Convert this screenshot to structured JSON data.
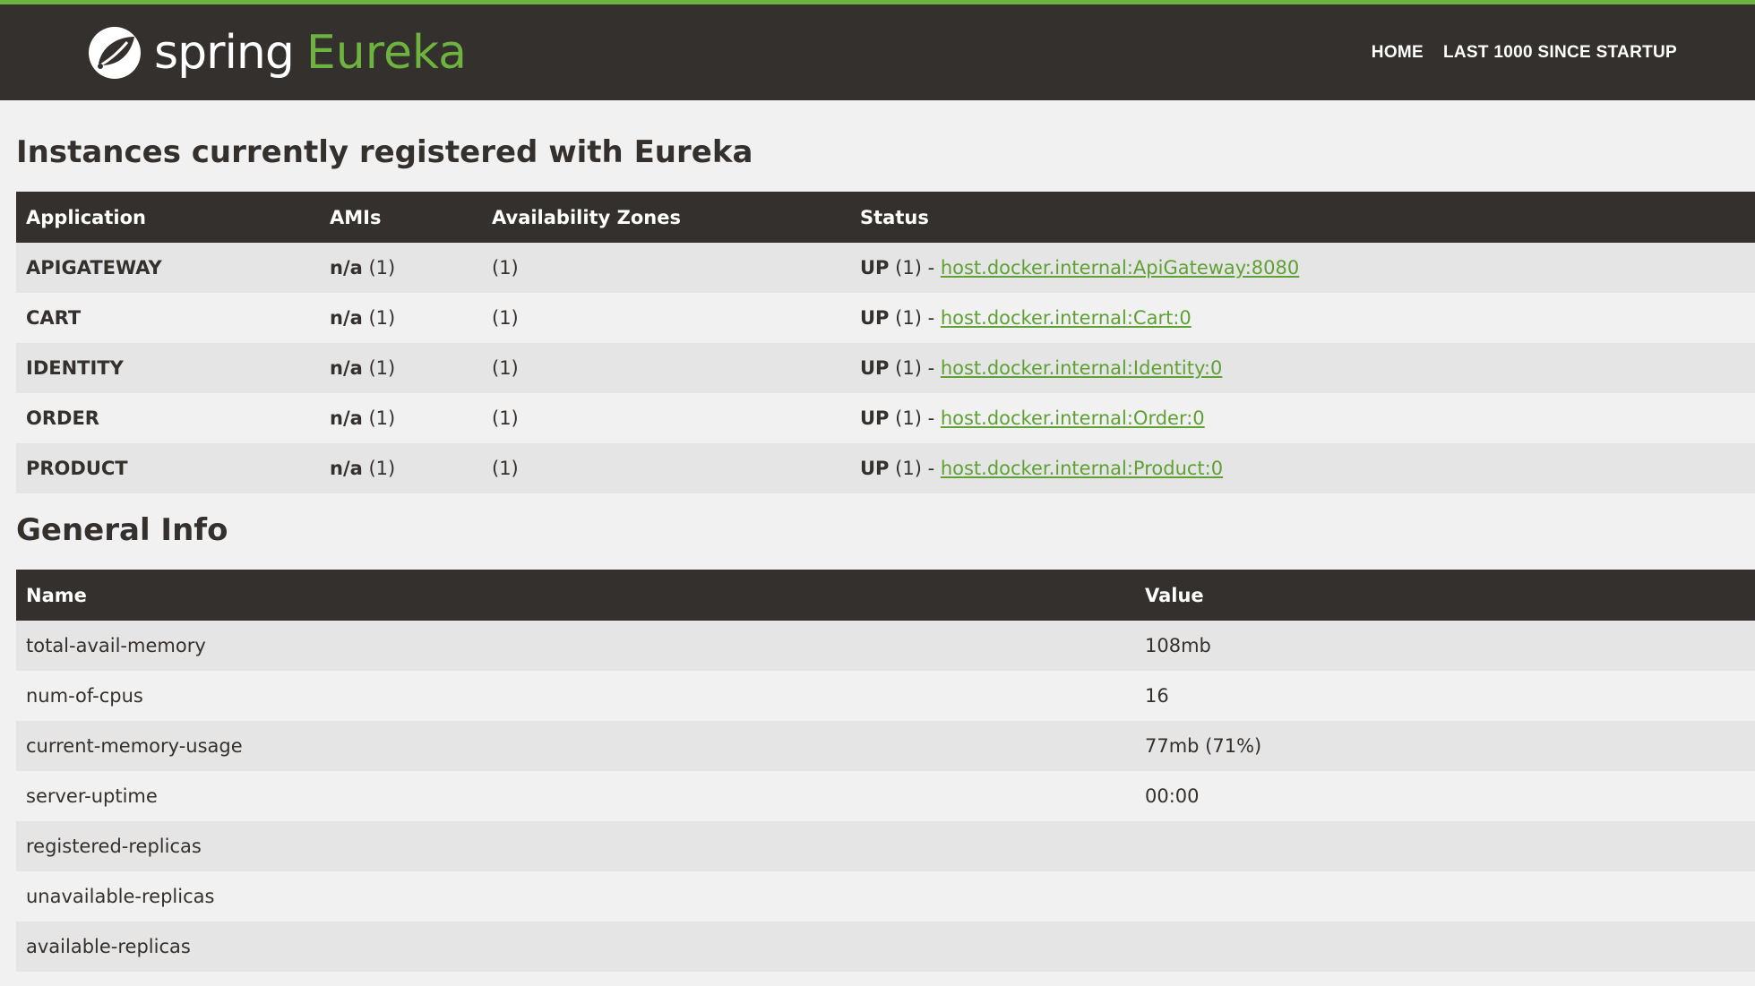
{
  "header": {
    "brand_spring": "spring",
    "brand_eureka": "Eureka",
    "nav": [
      {
        "label": "HOME"
      },
      {
        "label": "LAST 1000 SINCE STARTUP"
      }
    ],
    "accent_color": "#6db33f",
    "bar_color": "#34302d"
  },
  "instances": {
    "title": "Instances currently registered with Eureka",
    "columns": [
      "Application",
      "AMIs",
      "Availability Zones",
      "Status"
    ],
    "rows": [
      {
        "app": "APIGATEWAY",
        "ami_label": "n/a",
        "ami_count": "(1)",
        "zones": "(1)",
        "status": "UP",
        "status_count": "(1) -",
        "link": "host.docker.internal:ApiGateway:8080"
      },
      {
        "app": "CART",
        "ami_label": "n/a",
        "ami_count": "(1)",
        "zones": "(1)",
        "status": "UP",
        "status_count": "(1) -",
        "link": "host.docker.internal:Cart:0"
      },
      {
        "app": "IDENTITY",
        "ami_label": "n/a",
        "ami_count": "(1)",
        "zones": "(1)",
        "status": "UP",
        "status_count": "(1) -",
        "link": "host.docker.internal:Identity:0"
      },
      {
        "app": "ORDER",
        "ami_label": "n/a",
        "ami_count": "(1)",
        "zones": "(1)",
        "status": "UP",
        "status_count": "(1) -",
        "link": "host.docker.internal:Order:0"
      },
      {
        "app": "PRODUCT",
        "ami_label": "n/a",
        "ami_count": "(1)",
        "zones": "(1)",
        "status": "UP",
        "status_count": "(1) -",
        "link": "host.docker.internal:Product:0"
      }
    ]
  },
  "general_info": {
    "title": "General Info",
    "columns": [
      "Name",
      "Value"
    ],
    "rows": [
      {
        "name": "total-avail-memory",
        "value": "108mb"
      },
      {
        "name": "num-of-cpus",
        "value": "16"
      },
      {
        "name": "current-memory-usage",
        "value": "77mb (71%)"
      },
      {
        "name": "server-uptime",
        "value": "00:00"
      },
      {
        "name": "registered-replicas",
        "value": ""
      },
      {
        "name": "unavailable-replicas",
        "value": ""
      },
      {
        "name": "available-replicas",
        "value": ""
      }
    ]
  }
}
